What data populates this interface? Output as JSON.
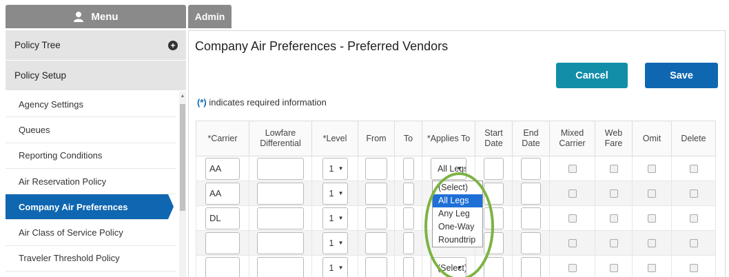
{
  "header": {
    "menu_label": "Menu",
    "admin_label": "Admin"
  },
  "sidebar": {
    "sections": [
      {
        "label": "Policy Tree"
      },
      {
        "label": "Policy Setup"
      }
    ],
    "items": [
      {
        "label": "Agency Settings"
      },
      {
        "label": "Queues"
      },
      {
        "label": "Reporting Conditions"
      },
      {
        "label": "Air Reservation Policy"
      },
      {
        "label": "Company Air Preferences",
        "active": true
      },
      {
        "label": "Air Class of Service Policy"
      },
      {
        "label": "Traveler Threshold Policy"
      }
    ]
  },
  "main": {
    "title": "Company Air Preferences - Preferred Vendors",
    "cancel_label": "Cancel",
    "save_label": "Save",
    "required_asterisk": "(*)",
    "required_text": " indicates required information",
    "columns": [
      "*Carrier",
      "Lowfare Differential",
      "*Level",
      "From",
      "To",
      "*Applies To",
      "Start Date",
      "End Date",
      "Mixed Carrier",
      "Web Fare",
      "Omit",
      "Delete"
    ],
    "rows": [
      {
        "carrier": "AA",
        "level": "1",
        "applies": "All Legs"
      },
      {
        "carrier": "AA",
        "level": "1",
        "applies": ""
      },
      {
        "carrier": "DL",
        "level": "1",
        "applies": ""
      },
      {
        "carrier": "",
        "level": "1",
        "applies": ""
      },
      {
        "carrier": "",
        "level": "1",
        "applies": "(Select)"
      }
    ],
    "dropdown": {
      "options": [
        "(Select)",
        "All Legs",
        "Any Leg",
        "One-Way",
        "Roundtrip"
      ],
      "highlighted": "All Legs"
    }
  },
  "colors": {
    "accent": "#0f67b1",
    "cancel": "#128ea9",
    "tab_gray": "#8a8a8a",
    "highlight_ring": "#7cb342"
  }
}
